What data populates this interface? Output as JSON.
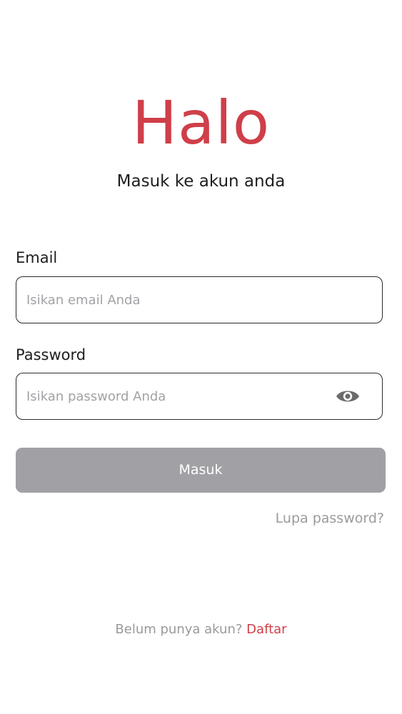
{
  "header": {
    "title": "Halo",
    "subtitle": "Masuk ke akun anda"
  },
  "form": {
    "email": {
      "label": "Email",
      "value": "",
      "placeholder": "Isikan email Anda"
    },
    "password": {
      "label": "Password",
      "value": "",
      "placeholder": "Isikan password Anda",
      "toggle_icon": "eye-icon"
    },
    "submit_label": "Masuk",
    "forgot_label": "Lupa password?"
  },
  "footer": {
    "prompt": "Belum punya akun?",
    "register_label": "Daftar"
  },
  "colors": {
    "accent": "#cf3f49",
    "button_disabled": "#a1a0a5",
    "muted_text": "#9a9a9e",
    "border": "#2b2b2b"
  }
}
